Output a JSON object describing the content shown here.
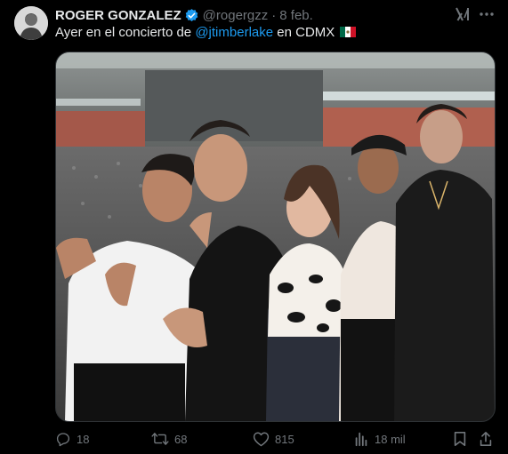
{
  "tweet": {
    "author": {
      "name": "ROGER GONZALEZ",
      "handle": "@rogergzz",
      "separator": "·",
      "date": "8 feb."
    },
    "text": {
      "prefix": "Ayer en el concierto de ",
      "mention": "@jtimberlake",
      "suffix": " en CDMX",
      "flag": "mexico-flag-emoji"
    },
    "media": {
      "description_icon": "photo"
    },
    "actions": {
      "replies": "18",
      "reposts": "68",
      "likes": "815",
      "views": "18 mil"
    }
  },
  "colors": {
    "background": "#000000",
    "text": "#e7e9ea",
    "muted": "#71767b",
    "accent": "#1d9bf0",
    "border": "#2f3336"
  }
}
